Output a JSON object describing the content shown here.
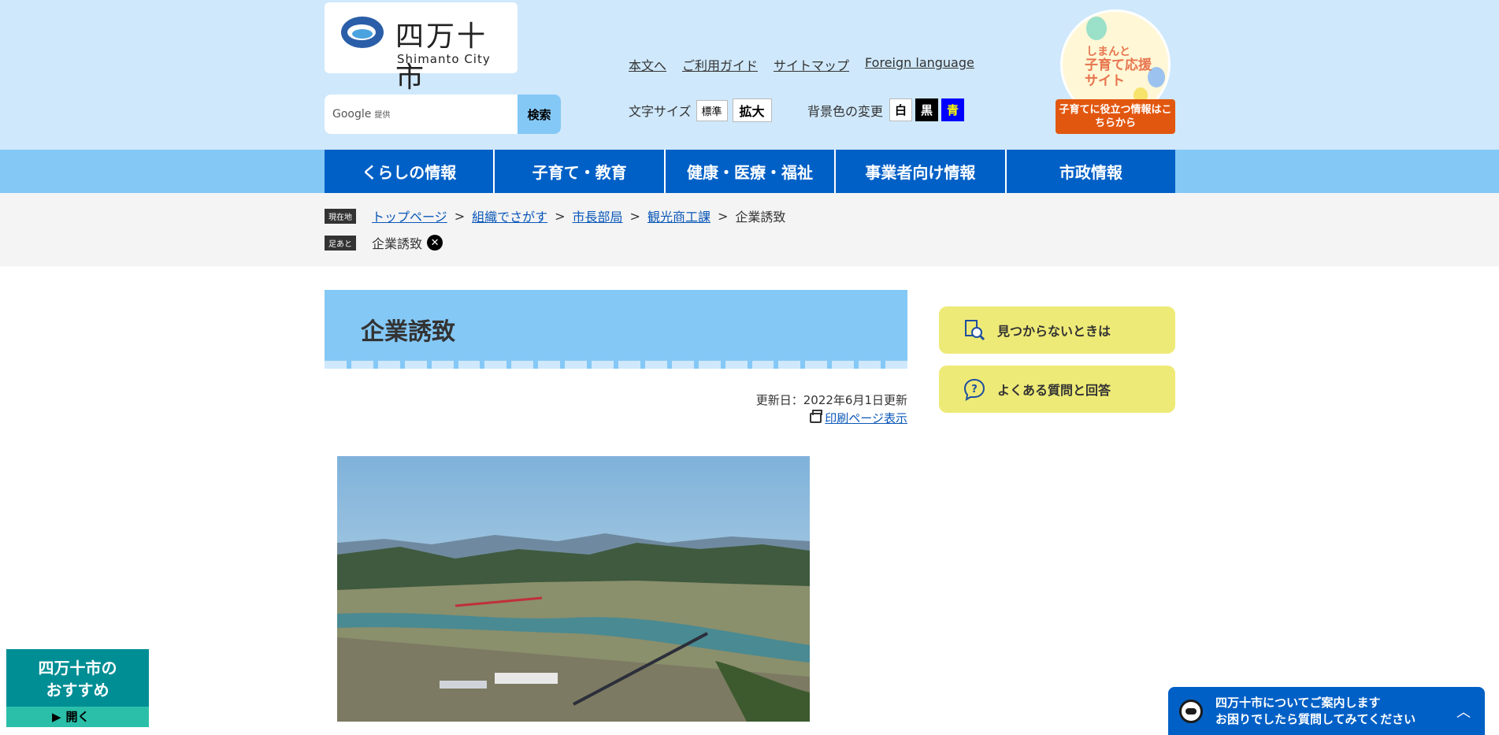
{
  "header": {
    "logo_title": "四万十市",
    "logo_subtitle": "Shimanto City",
    "search": {
      "provider": "Google",
      "provider_note": "提供",
      "button_label": "検索"
    },
    "util_links": [
      "本文へ",
      "ご利用ガイド",
      "サイトマップ",
      "Foreign language"
    ],
    "font_size": {
      "label": "文字サイズ",
      "options": [
        "標準",
        "拡大"
      ]
    },
    "bg_color": {
      "label": "背景色の変更",
      "options": [
        "白",
        "黒",
        "青"
      ]
    },
    "kosodate_banner": {
      "line1": "しまんと",
      "line2": "子育て応援サイト",
      "tag": "子育てに役立つ情報はこちらから"
    }
  },
  "gnav": [
    "くらしの情報",
    "子育て・教育",
    "健康・医療・福祉",
    "事業者向け情報",
    "市政情報"
  ],
  "breadcrumb": {
    "current_tag": "現在地",
    "items": [
      "トップページ",
      "組織でさがす",
      "市長部局",
      "観光商工課"
    ],
    "current": "企業誘致",
    "history_tag": "足あと",
    "history": "企業誘致"
  },
  "main": {
    "title": "企業誘致",
    "updated": "更新日：2022年6月1日更新",
    "print_link": "印刷ページ表示"
  },
  "sidebar": {
    "not_found": "見つからないときは",
    "faq": "よくある質問と回答"
  },
  "osusume": {
    "title_line1": "四万十市の",
    "title_line2": "おすすめ",
    "open": "開く"
  },
  "chatbot": {
    "line1": "四万十市についてご案内します",
    "line2": "お困りでしたら質問してみてください"
  }
}
